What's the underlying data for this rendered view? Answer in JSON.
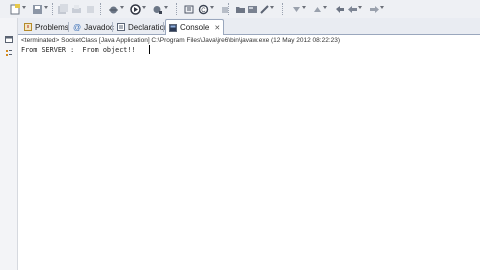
{
  "tabs": [
    {
      "label": "Problems",
      "icon": "problems-icon",
      "active": false
    },
    {
      "label": "Javadoc",
      "icon": "javadoc-icon",
      "active": false
    },
    {
      "label": "Declaration",
      "icon": "declaration-icon",
      "active": false
    },
    {
      "label": "Console",
      "icon": "console-icon",
      "active": true,
      "close": "✕"
    }
  ],
  "console": {
    "status": "<terminated> SocketClass [Java Application] C:\\Program Files\\Java\\jre6\\bin\\javaw.exe (12 May 2012 08:22:23)",
    "output": "From SERVER :  From object!!"
  },
  "colors": {
    "toolbar_bg": "#eef0f4",
    "tab_border": "#9aa7bd",
    "console_bg": "#ffffff"
  }
}
